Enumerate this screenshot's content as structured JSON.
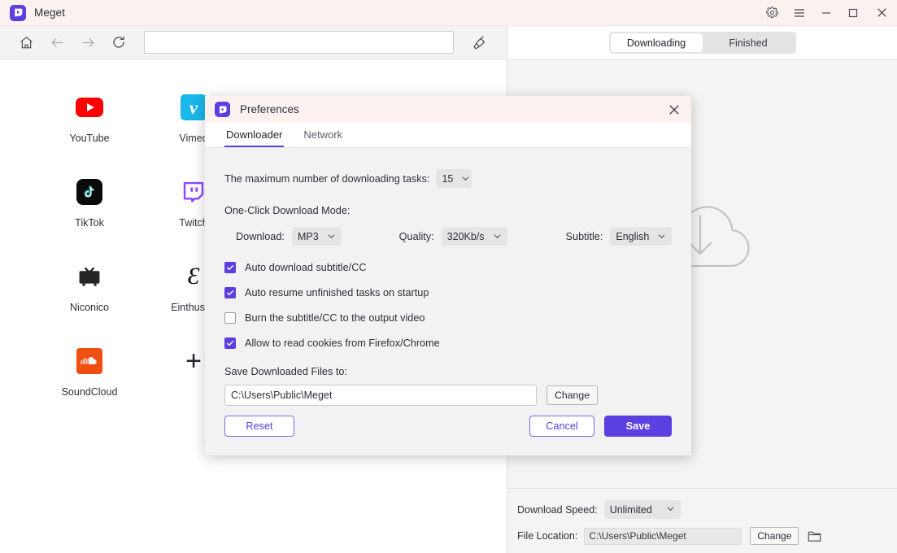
{
  "titlebar": {
    "app_name": "Meget",
    "logo_icon": "meget-logo-icon",
    "settings_icon": "gear-icon",
    "menu_icon": "hamburger-menu-icon",
    "minimize_icon": "minimize-icon",
    "maximize_icon": "maximize-icon",
    "close_icon": "close-icon",
    "accent": "#5b3fe0",
    "bg": "#fbf1ef"
  },
  "navbar": {
    "home_icon": "home-icon",
    "back_icon": "arrow-left-icon",
    "forward_icon": "arrow-right-icon",
    "reload_icon": "reload-icon",
    "broom_icon": "broom-icon",
    "url_value": "",
    "url_placeholder": ""
  },
  "sites": [
    {
      "label": "YouTube",
      "icon": "youtube-icon"
    },
    {
      "label": "Vimeo",
      "icon": "vimeo-icon"
    },
    {
      "label": "TikTok",
      "icon": "tiktok-icon"
    },
    {
      "label": "Twitch",
      "icon": "twitch-icon"
    },
    {
      "label": "Niconico",
      "icon": "niconico-icon"
    },
    {
      "label": "Einthusan",
      "icon": "einthusan-icon"
    },
    {
      "label": "SoundCloud",
      "icon": "soundcloud-icon"
    }
  ],
  "add_site": {
    "glyph": "+"
  },
  "right_panel": {
    "tabs": [
      {
        "label": "Downloading",
        "active": true
      },
      {
        "label": "Finished",
        "active": false
      }
    ],
    "empty_art_icon": "cloud-download-icon",
    "footer": {
      "speed_label": "Download Speed:",
      "speed_value": "Unlimited",
      "speed_caret_icon": "chevron-down-icon",
      "location_label": "File Location:",
      "location_value": "C:\\Users\\Public\\Meget",
      "change_label": "Change",
      "folder_icon": "folder-icon"
    }
  },
  "dialog": {
    "logo_icon": "meget-logo-icon",
    "title": "Preferences",
    "close_icon": "close-icon",
    "tabs": [
      {
        "label": "Downloader",
        "active": true
      },
      {
        "label": "Network",
        "active": false
      }
    ],
    "max_tasks": {
      "label": "The maximum number of downloading tasks:",
      "value": "15",
      "caret_icon": "chevron-down-icon"
    },
    "one_click": {
      "group_title": "One-Click Download Mode:",
      "download_label": "Download:",
      "download_value": "MP3",
      "quality_label": "Quality:",
      "quality_value": "320Kb/s",
      "subtitle_label": "Subtitle:",
      "subtitle_value": "English",
      "caret_icon": "chevron-down-icon"
    },
    "checkboxes": [
      {
        "label": "Auto download subtitle/CC",
        "checked": true
      },
      {
        "label": "Auto resume unfinished tasks on startup",
        "checked": true
      },
      {
        "label": "Burn the subtitle/CC to the output video",
        "checked": false
      },
      {
        "label": "Allow to read cookies from Firefox/Chrome",
        "checked": true
      }
    ],
    "save_path": {
      "label": "Save Downloaded Files to:",
      "value": "C:\\Users\\Public\\Meget",
      "change_label": "Change"
    },
    "buttons": {
      "reset": "Reset",
      "cancel": "Cancel",
      "save": "Save"
    }
  }
}
